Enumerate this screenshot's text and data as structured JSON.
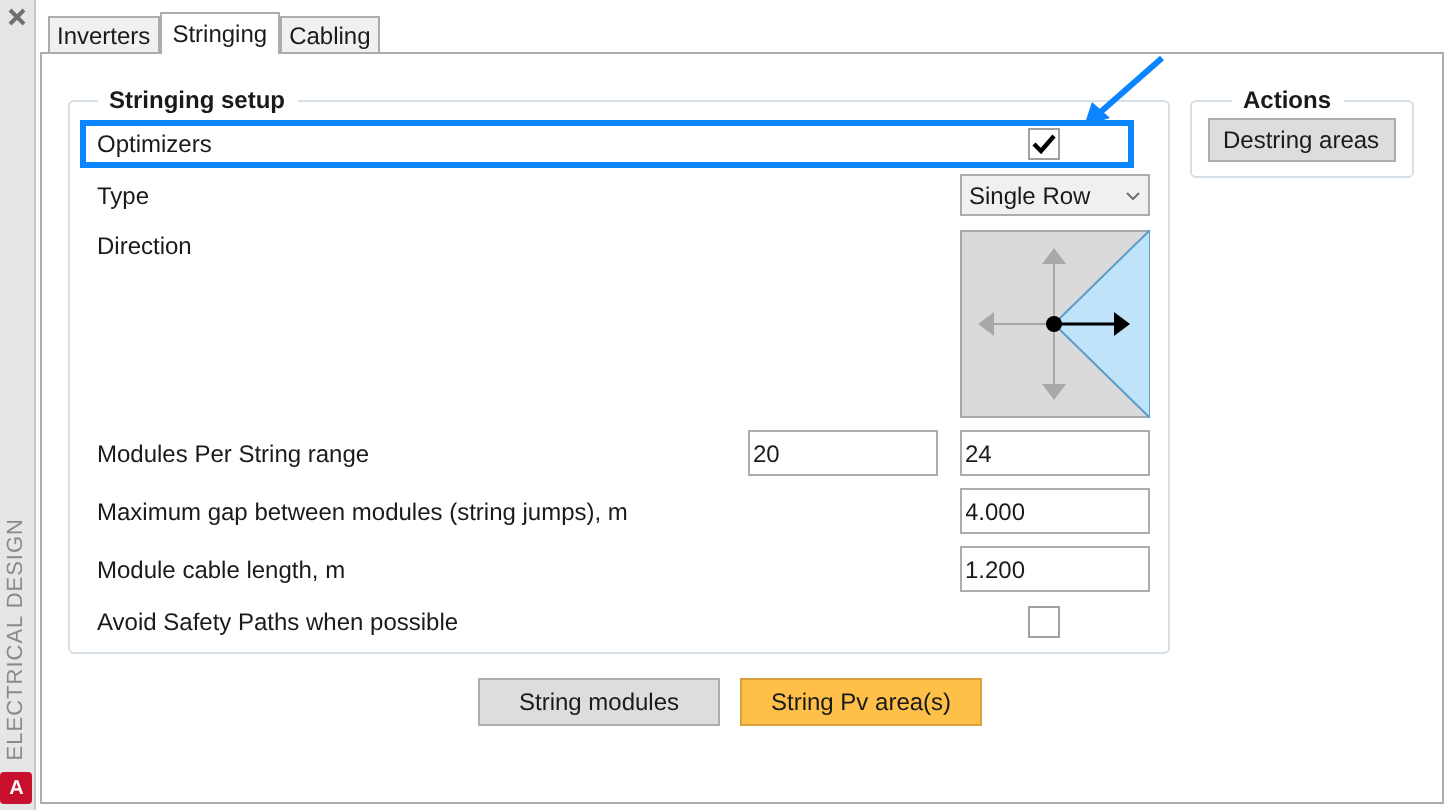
{
  "sidebar": {
    "label": "ELECTRICAL DESIGN",
    "app_badge": "A"
  },
  "tabs": [
    {
      "label": "Inverters",
      "selected": false
    },
    {
      "label": "Stringing",
      "selected": true
    },
    {
      "label": "Cabling",
      "selected": false
    }
  ],
  "setup": {
    "title": "Stringing setup",
    "optimizers": {
      "label": "Optimizers",
      "checked": true,
      "highlighted": true
    },
    "type": {
      "label": "Type",
      "value": "Single Row"
    },
    "direction": {
      "label": "Direction",
      "arrows": [
        {
          "kind": "up",
          "selected": false
        },
        {
          "kind": "down",
          "selected": false
        },
        {
          "kind": "left",
          "selected": false
        },
        {
          "kind": "right",
          "selected": true
        }
      ]
    },
    "fields": [
      {
        "label": "Modules Per String range",
        "values": [
          "20",
          "24"
        ]
      },
      {
        "label": "Maximum gap between modules (string jumps), m",
        "values": [
          "4.000"
        ]
      },
      {
        "label": "Module cable length, m",
        "values": [
          "1.200"
        ]
      }
    ],
    "avoid": {
      "label": "Avoid Safety Paths when possible",
      "checked": false
    }
  },
  "actions": {
    "title": "Actions",
    "buttons": [
      "Destring areas"
    ]
  },
  "buttons": [
    {
      "label": "String modules",
      "kind": "default"
    },
    {
      "label": "String Pv area(s)",
      "kind": "primary"
    }
  ]
}
